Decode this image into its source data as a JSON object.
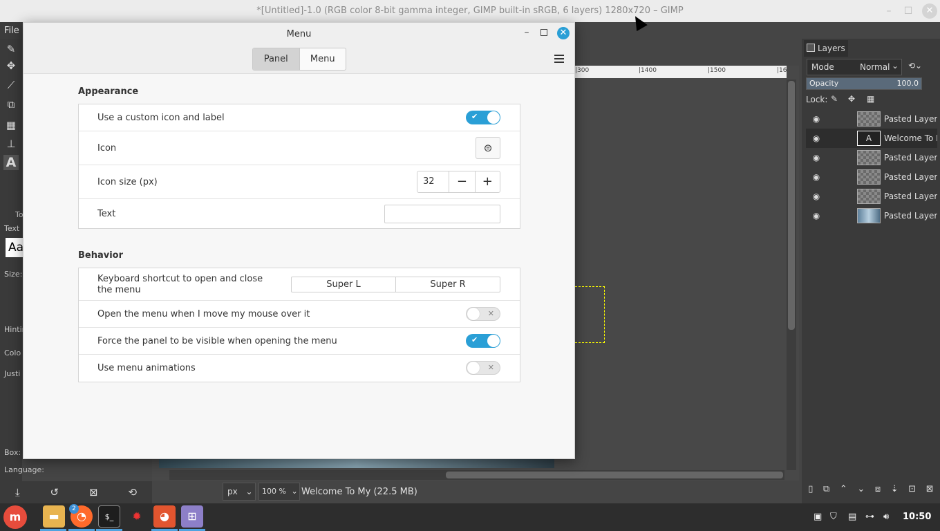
{
  "gimp": {
    "window_title": "*[Untitled]-1.0 (RGB color 8-bit gamma integer, GIMP built-in sRGB, 6 layers) 1280x720 – GIMP",
    "controls": {
      "minimize": "–",
      "maximize": "☐",
      "close": "✕"
    },
    "menu_file": "File",
    "tool_options": {
      "tab_label": "To",
      "text_label": "Text",
      "font_preview": "Aa",
      "size_label": "Size:",
      "hinting_label": "Hintin",
      "color_label": "Colo",
      "justify_label": "Justi",
      "box_label": "Box:",
      "language_label": "Language:"
    },
    "ruler": {
      "ticks": [
        "|300",
        "|1400",
        "|1500",
        "|16"
      ]
    },
    "status": {
      "unit": "px",
      "zoom": "100 %",
      "text": "Welcome To My (22.5 MB)"
    },
    "layers": {
      "tab_label": "Layers",
      "mode_label": "Mode",
      "mode_value": "Normal",
      "opacity_label": "Opacity",
      "opacity_value": "100.0",
      "lock_label": "Lock:",
      "items": [
        {
          "name": "Pasted Layer #",
          "thumb": "checker"
        },
        {
          "name": "Welcome To M",
          "thumb": "text"
        },
        {
          "name": "Pasted Layer #",
          "thumb": "checker"
        },
        {
          "name": "Pasted Layer #",
          "thumb": "checker"
        },
        {
          "name": "Pasted Layer #",
          "thumb": "checker"
        },
        {
          "name": "Pasted Layer",
          "thumb": "photo"
        }
      ]
    }
  },
  "dialog": {
    "title": "Menu",
    "tabs": [
      {
        "label": "Panel",
        "active": true
      },
      {
        "label": "Menu",
        "active": false
      }
    ],
    "appearance": {
      "title": "Appearance",
      "custom_icon_label": "Use a custom icon and label",
      "custom_icon_on": true,
      "icon_label": "Icon",
      "icon_size_label": "Icon size (px)",
      "icon_size_value": "32",
      "text_label": "Text",
      "text_value": ""
    },
    "behavior": {
      "title": "Behavior",
      "shortcut_label": "Keyboard shortcut to open and close the menu",
      "shortcut_1": "Super L",
      "shortcut_2": "Super R",
      "hover_label": "Open the menu when I move my mouse over it",
      "hover_on": false,
      "force_panel_label": "Force the panel to be visible when opening the menu",
      "force_panel_on": true,
      "animations_label": "Use menu animations",
      "animations_on": false
    }
  },
  "taskbar": {
    "files_badge": "2",
    "clock": "10:50"
  },
  "colors": {
    "accent": "#2a9fd6",
    "mint_red": "#e74c3c",
    "panel_dark": "#3a3a3a"
  }
}
